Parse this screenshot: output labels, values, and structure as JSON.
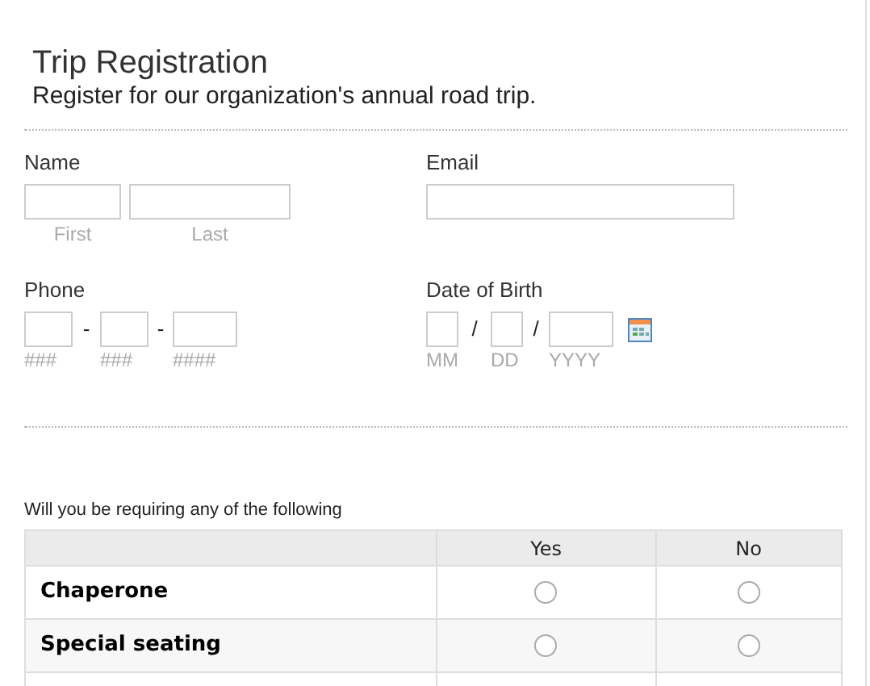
{
  "header": {
    "title": "Trip Registration",
    "subtitle": "Register for our organization's annual road trip."
  },
  "name": {
    "label": "Name",
    "parts": [
      {
        "sublabel": "First"
      },
      {
        "sublabel": "Last"
      }
    ]
  },
  "email": {
    "label": "Email"
  },
  "phone": {
    "label": "Phone",
    "parts": [
      {
        "sublabel": "###"
      },
      {
        "sublabel": "###"
      },
      {
        "sublabel": "####"
      }
    ],
    "separator": "-"
  },
  "dob": {
    "label": "Date of Birth",
    "parts": [
      {
        "sublabel": "MM"
      },
      {
        "sublabel": "DD"
      },
      {
        "sublabel": "YYYY"
      }
    ],
    "separator": "/"
  },
  "matrix": {
    "question": "Will you be requiring any of the following",
    "columns": [
      "Yes",
      "No"
    ],
    "rows": [
      {
        "label": "Chaperone",
        "choices": [
          {
            "selected": false
          },
          {
            "selected": false
          }
        ]
      },
      {
        "label": "Special seating",
        "choices": [
          {
            "selected": false
          },
          {
            "selected": false
          }
        ]
      }
    ]
  }
}
